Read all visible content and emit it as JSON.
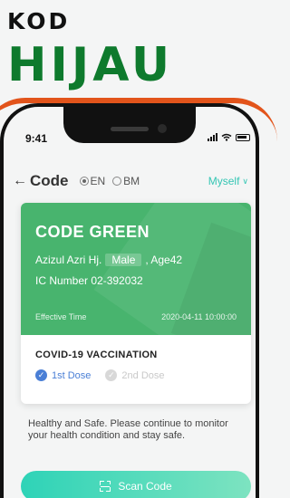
{
  "promo": {
    "line1": "KOD",
    "line2": "HIJAU",
    "line2_color": "#0e7a2d",
    "frame_accent": "#e2541b"
  },
  "status_bar": {
    "time": "9:41",
    "icons": [
      "signal-icon",
      "wifi-icon",
      "battery-icon"
    ]
  },
  "header": {
    "back_icon": "arrow-left-icon",
    "title": "Code",
    "languages": [
      {
        "label": "EN",
        "selected": true
      },
      {
        "label": "BM",
        "selected": false
      }
    ],
    "profile": {
      "label": "Myself",
      "icon": "chevron-down-icon"
    },
    "accent": "#35c6b4"
  },
  "card": {
    "background": "#48b46e",
    "status": "CODE GREEN",
    "name": "Azizul Azri Hj.",
    "gender": "Male",
    "age": ", Age42",
    "ic_number": "IC Number 02-392032",
    "effective_label": "Effective Time",
    "effective_value": "2020-04-11 10:00:00",
    "vaccination": {
      "title": "COVID-19 VACCINATION",
      "doses": [
        {
          "label": "1st Dose",
          "done": true,
          "color": "#4a7fd6"
        },
        {
          "label": "2nd Dose",
          "done": false,
          "color": "#c9c9c9"
        }
      ]
    }
  },
  "message": "Healthy and Safe. Please continue to monitor your health condition and stay safe.",
  "scan_button": {
    "label": "Scan Code",
    "icon": "scan-icon",
    "gradient": [
      "#2ed3b7",
      "#7de3c0"
    ]
  }
}
